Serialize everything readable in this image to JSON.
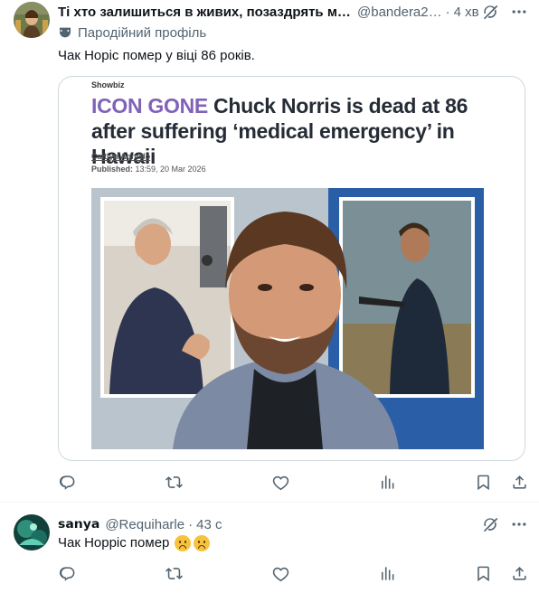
{
  "post1": {
    "author_name": "Ті хто залишиться в живих, позаздрять ме…",
    "handle": "@bandera2…",
    "separator": "·",
    "time": "4 хв",
    "parody_label": "Пародійний профіль",
    "text": "Чак Норіс помер у віці 86 років.",
    "article": {
      "section": "Showbiz",
      "headline_lead": "ICON GONE",
      "headline_rest": " Chuck Norris is dead at 86 after suffering ‘medical emergency’ in Hawaii",
      "author": "Caitlyn Agnello",
      "published_label": "Published:",
      "published_value": " 13:59, 20 Mar 2026"
    }
  },
  "post2": {
    "author_name": "𝘀𝗮𝗻𝘆𝗮",
    "handle": "@Requiharle",
    "separator": "·",
    "time": "43 с",
    "text": "Чак Норріс помер"
  },
  "icons": {
    "grok": "grok-icon",
    "more": "more-icon",
    "parody": "parody-mask-icon",
    "reply": "reply-icon",
    "repost": "repost-icon",
    "like": "like-icon",
    "views": "views-icon",
    "bookmark": "bookmark-icon",
    "share": "share-icon"
  },
  "colors": {
    "text": "#0f1419",
    "secondary": "#536471",
    "border": "#cfd9de",
    "headline_accent": "#8161b9",
    "headline": "#262c36"
  }
}
